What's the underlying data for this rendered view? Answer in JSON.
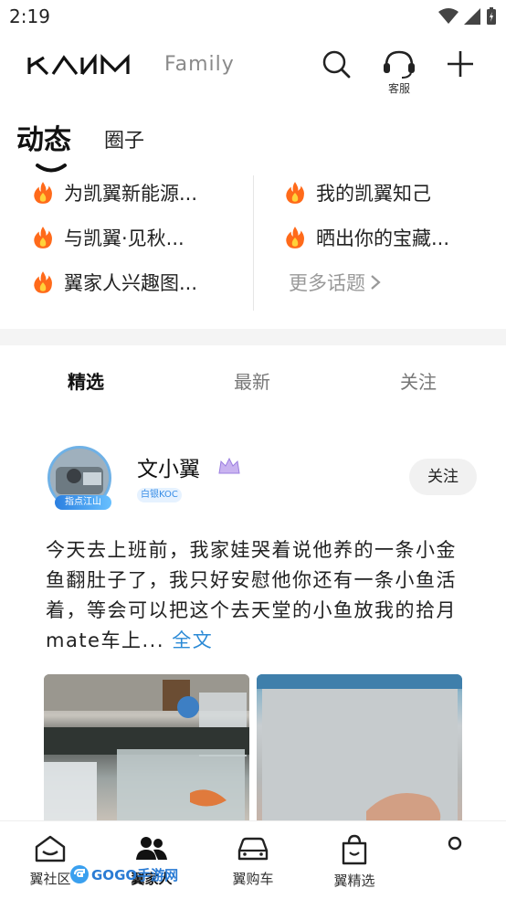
{
  "status_bar": {
    "time": "2:19"
  },
  "header": {
    "brand_family": "Family",
    "service_label": "客服"
  },
  "top_tabs": [
    {
      "label": "动态"
    },
    {
      "label": "圈子"
    }
  ],
  "topics": {
    "left": [
      "为凯翼新能源...",
      "与凯翼·见秋...",
      "翼家人兴趣图..."
    ],
    "right": [
      "我的凯翼知己",
      "晒出你的宝藏..."
    ],
    "more": "更多话题"
  },
  "feed_tabs": [
    {
      "label": "精选"
    },
    {
      "label": "最新"
    },
    {
      "label": "关注"
    }
  ],
  "post": {
    "author": "文小翼",
    "avatar_tag": "指点江山",
    "koc_badge": "白银KOC",
    "follow_label": "关注",
    "text": "今天去上班前，我家娃哭着说他养的一条小金鱼翻肚子了，我只好安慰他你还有一条小鱼活着，等会可以把这个去天堂的小鱼放我的拾月mate车上...",
    "read_more": "全文"
  },
  "bottom_nav": [
    {
      "label": "翼社区"
    },
    {
      "label": "翼家人"
    },
    {
      "label": "翼购车"
    },
    {
      "label": "翼精选"
    }
  ],
  "watermark": "GOGO手游网",
  "colors": {
    "accent_link": "#2b8ad6",
    "fire": "#ff6a1a"
  }
}
